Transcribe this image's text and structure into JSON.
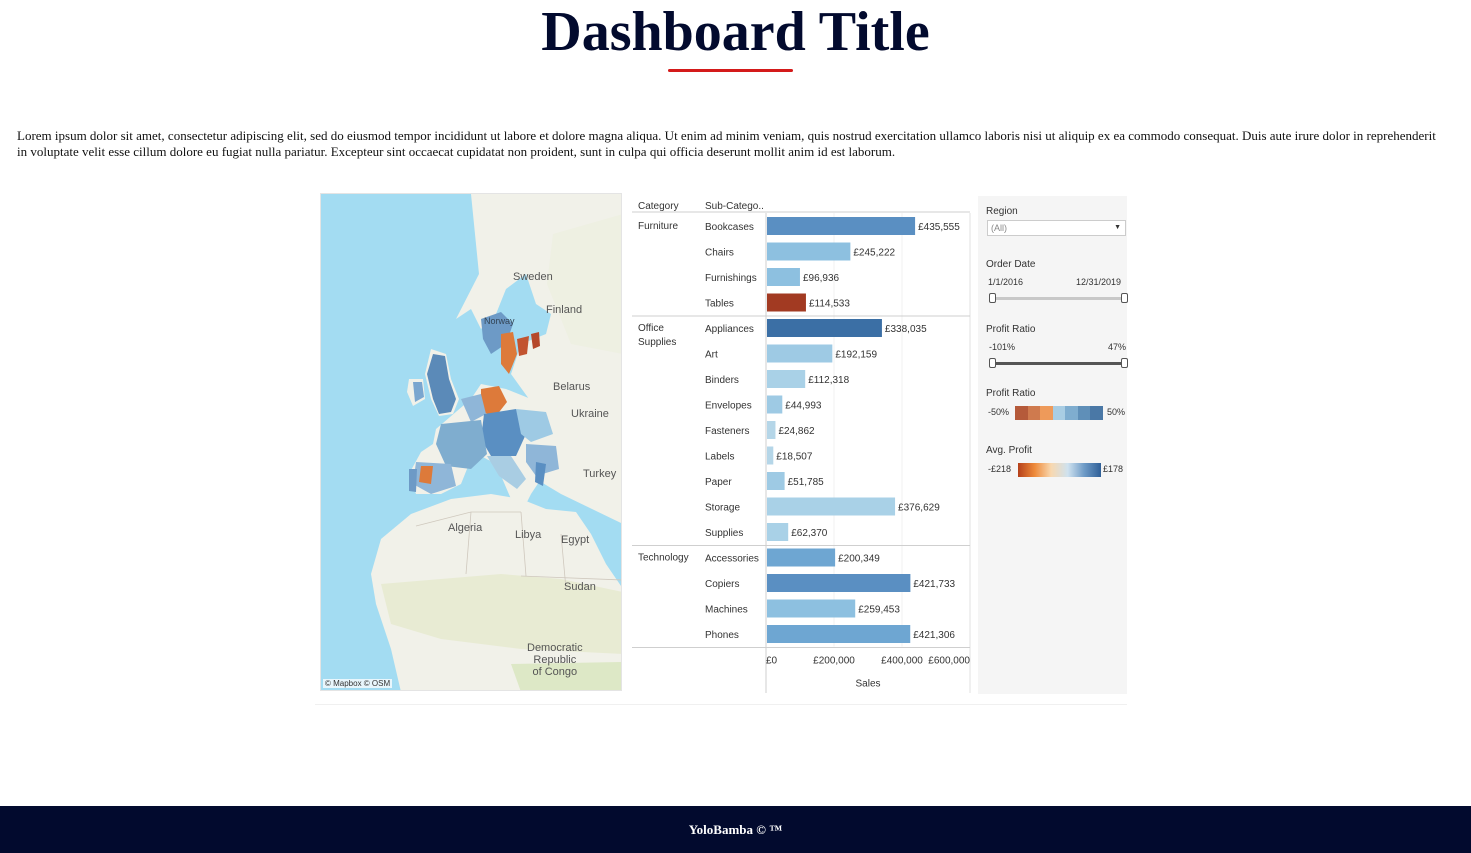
{
  "page": {
    "title": "Dashboard Title",
    "intro": "Lorem ipsum dolor sit amet, consectetur adipiscing elit, sed do eiusmod tempor incididunt ut labore et dolore magna aliqua. Ut enim ad minim veniam, quis nostrud exercitation ullamco laboris nisi ut aliquip ex ea commodo consequat. Duis aute irure dolor in reprehenderit in voluptate velit esse cillum dolore eu fugiat nulla pariatur. Excepteur sint occaecat cupidatat non proident, sunt in culpa qui officia deserunt mollit anim id est laborum.",
    "footer": "YoloBamba © ™",
    "accent_color": "#d41a1a",
    "navy_color": "#020a2e"
  },
  "map": {
    "labels": {
      "sweden": "Sweden",
      "finland": "Finland",
      "norway": "Norway",
      "belarus": "Belarus",
      "ukraine": "Ukraine",
      "turkey": "Turkey",
      "algeria": "Algeria",
      "libya": "Libya",
      "egypt": "Egypt",
      "sudan": "Sudan",
      "drc": [
        "Democratic",
        "Republic",
        "of Congo"
      ]
    },
    "attribution": "© Mapbox  © OSM",
    "water_color": "#a3dcf2",
    "land_color": "#f1f1e9"
  },
  "chart_data": {
    "type": "bar",
    "orientation": "horizontal",
    "header_category": "Category",
    "header_subcategory": "Sub-Catego..",
    "xlabel": "Sales",
    "xlim": [
      0,
      600000
    ],
    "x_ticks": [
      "£0",
      "£200,000",
      "£400,000",
      "£600,000"
    ],
    "x_tick_values": [
      0,
      200000,
      400000,
      600000
    ],
    "groups": [
      {
        "category": [
          "Furniture"
        ],
        "items": [
          {
            "name": "Bookcases",
            "value": 435555,
            "label": "£435,555",
            "color": "#5a8fc2"
          },
          {
            "name": "Chairs",
            "value": 245222,
            "label": "£245,222",
            "color": "#8dc0e0"
          },
          {
            "name": "Furnishings",
            "value": 96936,
            "label": "£96,936",
            "color": "#8dc0e0"
          },
          {
            "name": "Tables",
            "value": 114533,
            "label": "£114,533",
            "color": "#a23a22"
          }
        ]
      },
      {
        "category": [
          "Office",
          "Supplies"
        ],
        "items": [
          {
            "name": "Appliances",
            "value": 338035,
            "label": "£338,035",
            "color": "#3b6fa5"
          },
          {
            "name": "Art",
            "value": 192159,
            "label": "£192,159",
            "color": "#9ecae4"
          },
          {
            "name": "Binders",
            "value": 112318,
            "label": "£112,318",
            "color": "#a9d1e7"
          },
          {
            "name": "Envelopes",
            "value": 44993,
            "label": "£44,993",
            "color": "#9ecae4"
          },
          {
            "name": "Fasteners",
            "value": 24862,
            "label": "£24,862",
            "color": "#b5d6e8"
          },
          {
            "name": "Labels",
            "value": 18507,
            "label": "£18,507",
            "color": "#b5d6e8"
          },
          {
            "name": "Paper",
            "value": 51785,
            "label": "£51,785",
            "color": "#9ecae4"
          },
          {
            "name": "Storage",
            "value": 376629,
            "label": "£376,629",
            "color": "#a9d1e7"
          },
          {
            "name": "Supplies",
            "value": 62370,
            "label": "£62,370",
            "color": "#a9d1e7"
          }
        ]
      },
      {
        "category": [
          "Technology"
        ],
        "items": [
          {
            "name": "Accessories",
            "value": 200349,
            "label": "£200,349",
            "color": "#6ea6d2"
          },
          {
            "name": "Copiers",
            "value": 421733,
            "label": "£421,733",
            "color": "#5a8fc2"
          },
          {
            "name": "Machines",
            "value": 259453,
            "label": "£259,453",
            "color": "#8dc0e0"
          },
          {
            "name": "Phones",
            "value": 421306,
            "label": "£421,306",
            "color": "#6ea6d2"
          }
        ]
      }
    ]
  },
  "filters": {
    "region": {
      "label": "Region",
      "value": "(All)"
    },
    "order_date": {
      "label": "Order Date",
      "min": "1/1/2016",
      "max": "12/31/2019"
    },
    "profit_ratio_slider": {
      "label": "Profit Ratio",
      "min": "-101%",
      "max": "47%"
    },
    "profit_ratio_legend": {
      "label": "Profit Ratio",
      "min": "-50%",
      "max": "50%",
      "steps": [
        "#b55a3a",
        "#cf7a4e",
        "#ee9a5a",
        "#a9cde3",
        "#7fadcf",
        "#5f8fb8",
        "#4a78a6"
      ]
    },
    "avg_profit_legend": {
      "label": "Avg. Profit",
      "min": "-£218",
      "max": "£178"
    }
  }
}
